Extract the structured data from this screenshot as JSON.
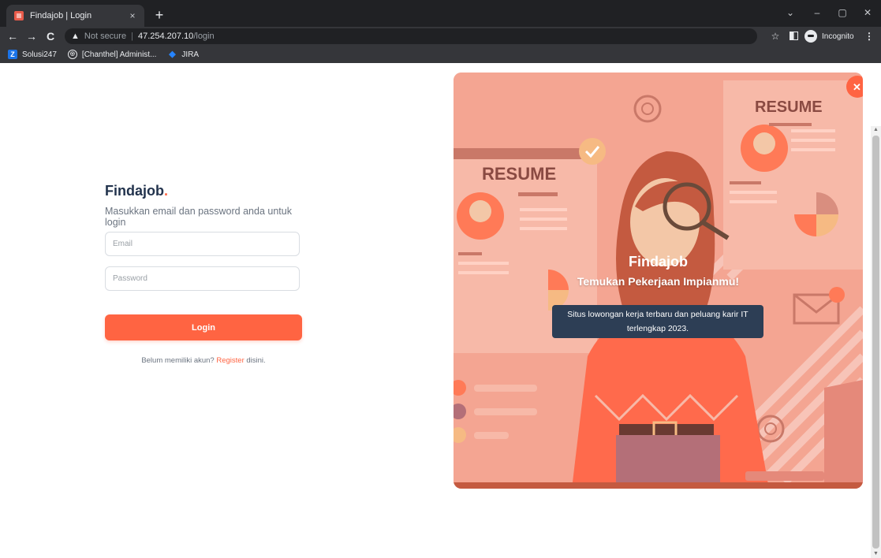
{
  "browser": {
    "tab_title": "Findajob | Login",
    "tab_close": "×",
    "new_tab": "+",
    "window_controls": {
      "dropdown": "⌄",
      "minimize": "–",
      "restore": "▢",
      "close": "✕"
    },
    "nav": {
      "back": "←",
      "forward": "→",
      "reload": "C"
    },
    "url": {
      "warning_label": "Not secure",
      "host": "47.254.207.10",
      "path": "/login"
    },
    "bookmarks": [
      {
        "label": "Solusi247"
      },
      {
        "label": "[Chanthel] Administ..."
      },
      {
        "label": "JIRA"
      }
    ],
    "incognito_label": "Incognito",
    "menu": "⋮"
  },
  "login": {
    "brand": "Findajob",
    "brand_dot": ".",
    "subtitle": "Masukkan email dan password anda untuk login",
    "email_placeholder": "Email",
    "password_placeholder": "Password",
    "submit_label": "Login",
    "register_prefix": "Belum memiliki akun?",
    "register_link": "Register",
    "register_suffix": "disini."
  },
  "hero": {
    "title": "Findajob",
    "tagline": "Temukan Pekerjaan Impianmu!",
    "description": "Situs lowongan kerja terbaru dan peluang karir IT terlengkap 2023.",
    "resume_label": "RESUME",
    "close": "✕"
  },
  "colors": {
    "accent": "#ff6442",
    "brand_text": "#22334d",
    "hero_bg": "#f4a592"
  }
}
